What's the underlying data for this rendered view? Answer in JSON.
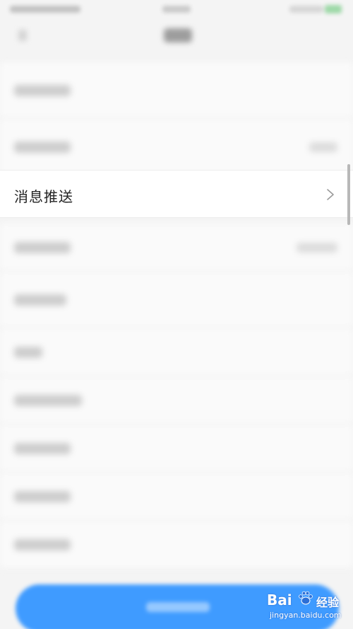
{
  "settings_list": {
    "focused_item": {
      "label": "消息推送",
      "icon": "chevron-right-icon"
    }
  },
  "watermark": {
    "brand": "Bai",
    "brand_suffix": "经验",
    "url": "jingyan.baidu.com",
    "icon": "baidu-paw-icon"
  },
  "colors": {
    "primary_button": "#3f9bff",
    "background": "#f4f4f4",
    "focused_row": "#ffffff"
  }
}
